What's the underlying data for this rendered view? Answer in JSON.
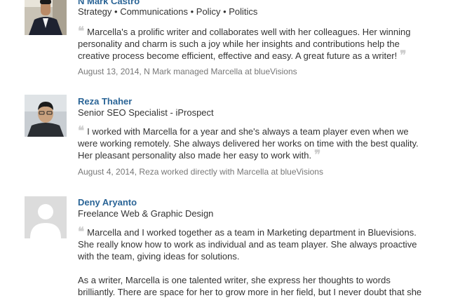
{
  "recommendations": [
    {
      "name": "N Mark Castro",
      "headline": "Strategy • Communications • Policy • Politics",
      "text": [
        "Marcella's a prolific writer and collaborates well with her colleagues. Her winning personality and charm is such a joy while her insights and contributions help the creative process become efficient, effective and easy. A great future as a writer!"
      ],
      "meta": "August 13, 2014, N Mark managed Marcella at blueVisions",
      "avatar": "profile-photo"
    },
    {
      "name": "Reza Thaher",
      "headline": "Senior SEO Specialist - iProspect",
      "text": [
        "I worked with Marcella for a year and she's always a team player even when we were working remotely. She always delivered her works on time with the best quality. Her pleasant personality also made her easy to work with."
      ],
      "meta": "August 4, 2014, Reza worked directly with Marcella at blueVisions",
      "avatar": "profile-photo"
    },
    {
      "name": "Deny Aryanto",
      "headline": "Freelance Web & Graphic Design",
      "text": [
        "Marcella and I worked together as a team in Marketing department in Bluevisions. She really know how to work as individual and as team player. She always proactive with the team, giving ideas for solutions.",
        "As a writer, Marcella is one talented writer, she express her thoughts to words brilliantly. There are space for her to grow more in her field, but I never doubt that she"
      ],
      "meta": "",
      "avatar": "default-avatar"
    }
  ],
  "quote_open": "❝",
  "quote_close": "❞",
  "colors": {
    "link": "#2a6496",
    "text": "#333333",
    "meta": "#777777",
    "quote_mark": "#cfcfcf",
    "placeholder_bg": "#dcdcdc"
  }
}
